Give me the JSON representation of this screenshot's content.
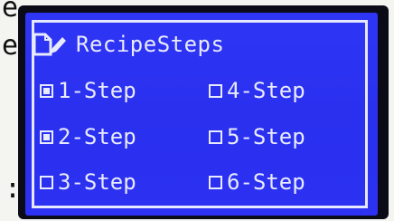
{
  "display": {
    "title": "RecipeSteps",
    "title_icon": "document-edit-icon",
    "edge_marks": {
      "top": "e",
      "middle": "e",
      "bottom": ":"
    },
    "steps": [
      {
        "label": "1-Step",
        "checked": true
      },
      {
        "label": "2-Step",
        "checked": true
      },
      {
        "label": "3-Step",
        "checked": false
      },
      {
        "label": "4-Step",
        "checked": false
      },
      {
        "label": "5-Step",
        "checked": false
      },
      {
        "label": "6-Step",
        "checked": false
      }
    ],
    "colors": {
      "screen": "#2f35f5",
      "text": "#e8eaff",
      "bezel": "#0b0b18"
    }
  }
}
